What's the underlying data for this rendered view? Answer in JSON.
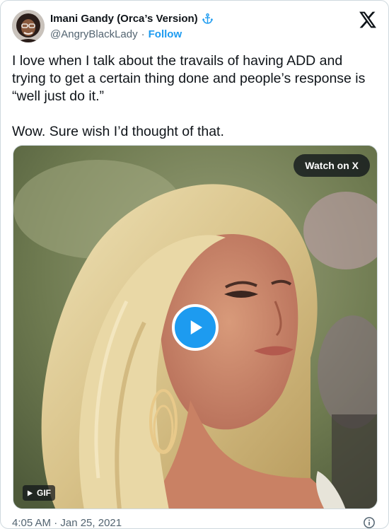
{
  "author": {
    "display_name": "Imani Gandy (Orca’s Version)",
    "handle": "@AngryBlackLady",
    "separator": "·",
    "follow_label": "Follow",
    "badge_icon": "anchor-icon"
  },
  "brand": {
    "logo_icon": "x-logo-icon"
  },
  "tweet": {
    "paragraphs": [
      "I love when I talk about the travails of having ADD and trying to get a certain thing done and people’s response is “well just do it.”",
      "Wow. Sure wish I’d thought of that."
    ]
  },
  "media": {
    "watch_label": "Watch on X",
    "gif_label": "GIF",
    "play_icon": "play-icon"
  },
  "footer": {
    "timestamp": "4:05 AM · Jan 25, 2021",
    "info_icon": "info-icon"
  },
  "colors": {
    "accent": "#1d9bf0",
    "text": "#0f1419",
    "muted": "#536471",
    "border": "#cfd9de"
  }
}
